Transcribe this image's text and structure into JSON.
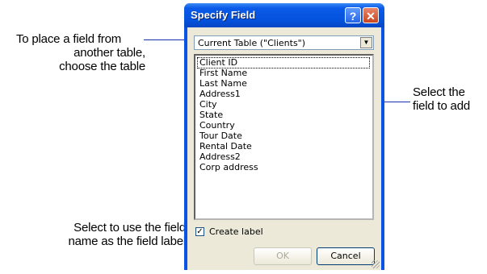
{
  "callouts": {
    "choose_table": [
      "To place a field from",
      "another table,",
      "choose the table"
    ],
    "select_field": [
      "Select the",
      "field to add"
    ],
    "create_label": [
      "Select to use the field",
      "name as the field label"
    ]
  },
  "dialog": {
    "title": "Specify Field",
    "help_button": "?",
    "close_button": "✕",
    "table_select": {
      "value": "Current Table (\"Clients\")"
    },
    "fields": [
      "Client ID",
      "First Name",
      "Last Name",
      "Address1",
      "City",
      "State",
      "Country",
      "Tour Date",
      "Rental Date",
      "Address2",
      "Corp address"
    ],
    "selected_field": "Client ID",
    "create_label": {
      "label": "Create label",
      "checked": true
    },
    "ok_label": "OK",
    "cancel_label": "Cancel"
  }
}
